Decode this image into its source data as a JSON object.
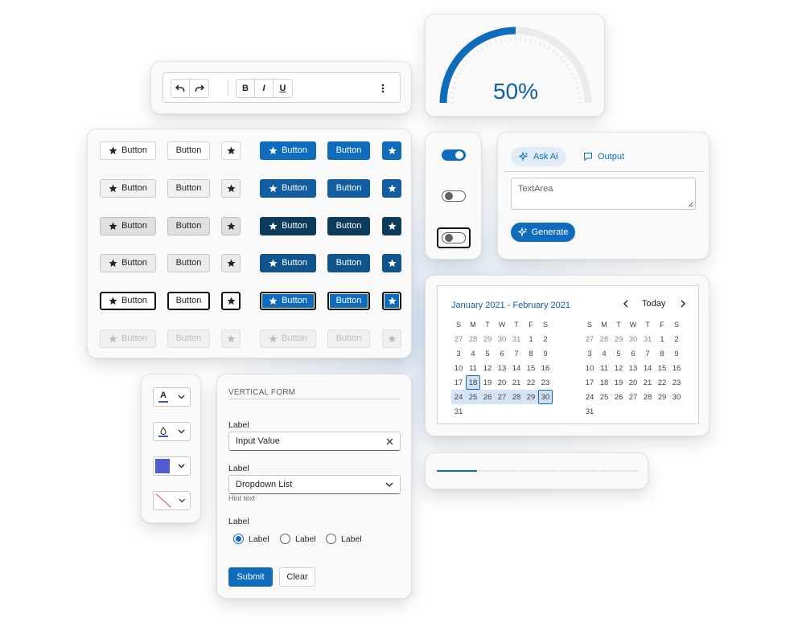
{
  "toolbar": {
    "bold_label": "B",
    "italic_label": "I",
    "underline_label": "U"
  },
  "buttons": {
    "label": "Button",
    "rows": [
      "rest",
      "hover",
      "pressed",
      "selected",
      "focus",
      "disabled"
    ]
  },
  "gauge": {
    "value_text": "50%",
    "fraction": 0.5,
    "color": "#0f6cbd"
  },
  "toggles": [
    {
      "state": "on"
    },
    {
      "state": "off"
    },
    {
      "state": "off",
      "focused": true
    }
  ],
  "ai_panel": {
    "tab_ask": "Ask Ai",
    "tab_output": "Output",
    "textarea_placeholder": "TextArea",
    "generate_label": "Generate"
  },
  "calendar": {
    "range_title": "January 2021 - February 2021",
    "today_label": "Today",
    "weekdays": [
      "S",
      "M",
      "T",
      "W",
      "T",
      "F",
      "S"
    ],
    "left_month": [
      [
        "27",
        "28",
        "29",
        "30",
        "31",
        "1",
        "2"
      ],
      [
        "3",
        "4",
        "5",
        "6",
        "7",
        "8",
        "9"
      ],
      [
        "10",
        "11",
        "12",
        "13",
        "14",
        "15",
        "16"
      ],
      [
        "17",
        "18",
        "19",
        "20",
        "21",
        "22",
        "23"
      ],
      [
        "24",
        "25",
        "26",
        "27",
        "28",
        "29",
        "30"
      ],
      [
        "31",
        "",
        "",
        "",
        "",
        "",
        ""
      ]
    ],
    "right_month": [
      [
        "27",
        "28",
        "29",
        "30",
        "31",
        "1",
        "2"
      ],
      [
        "3",
        "4",
        "5",
        "6",
        "7",
        "8",
        "9"
      ],
      [
        "10",
        "11",
        "12",
        "13",
        "14",
        "15",
        "16"
      ],
      [
        "17",
        "18",
        "19",
        "20",
        "21",
        "22",
        "23"
      ],
      [
        "24",
        "25",
        "26",
        "27",
        "28",
        "29",
        "30"
      ],
      [
        "31",
        "",
        "",
        "",
        "",
        "",
        ""
      ]
    ],
    "range_start": "18",
    "range_end": "30"
  },
  "progress": {
    "fraction": 0.2,
    "color": "#0f6cbd"
  },
  "color_pickers": {
    "font_color_letter": "A",
    "font_color": "#3f51b5",
    "fill_swatch": "#4f5bd5",
    "none_line_color": "#d13438"
  },
  "form": {
    "heading": "VERTICAL FORM",
    "input_label": "Label",
    "input_value": "Input Value",
    "dropdown_label": "Label",
    "dropdown_value": "Dropdown List",
    "hint": "Hint text",
    "radio_group_label": "Label",
    "radios": [
      "Label",
      "Label",
      "Label"
    ],
    "submit_label": "Submit",
    "clear_label": "Clear"
  }
}
